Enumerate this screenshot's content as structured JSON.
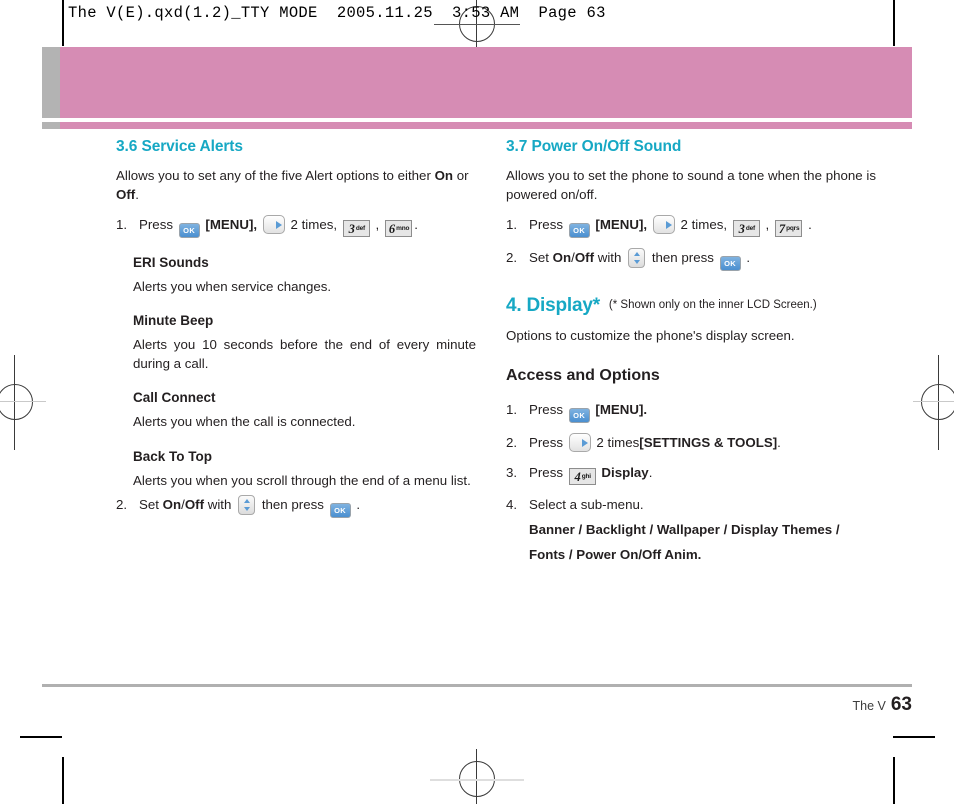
{
  "page": {
    "slug": "The V(E).qxd(1.2)_TTY MODE  2005.11.25  3:53 AM  Page 63",
    "footer_label": "The V",
    "footer_page": "63",
    "accent_color": "#16a8c4",
    "banner_color": "#d68cb4",
    "banner_tab_color": "#b3b3b3"
  },
  "left_column": {
    "section": {
      "number": "3.6",
      "title": "Service Alerts",
      "full_heading": "3.6 Service Alerts"
    },
    "intro_parts": {
      "a": "Allows you to set any of the five Alert options to either ",
      "on": "On",
      "b": " or ",
      "off": "Off",
      "c": "."
    },
    "step1": {
      "num": "1.",
      "press": "Press",
      "menu": "[MENU],",
      "times": "2 times,",
      "comma": ",",
      "period": "."
    },
    "subsections": [
      {
        "title": "ERI Sounds",
        "body": "Alerts you when service changes."
      },
      {
        "title": "Minute Beep",
        "body": "Alerts you 10 seconds before the end of every minute during a call."
      },
      {
        "title": "Call Connect",
        "body": "Alerts you when the call is connected."
      },
      {
        "title": "Back To Top",
        "body": "Alerts you when you scroll through the end of a menu list."
      }
    ],
    "step2": {
      "num": "2.",
      "set": "Set",
      "on": "On",
      "slash": "/",
      "off": "Off",
      "with": "with",
      "then_press": "then press",
      "period": "."
    },
    "keys": {
      "ok": "OK",
      "k3_digit": "3",
      "k3_letters": "def",
      "k6_digit": "6",
      "k6_letters": "mno"
    }
  },
  "right_column": {
    "section37": {
      "number": "3.7",
      "title": "Power On/Off Sound",
      "full_heading": "3.7 Power On/Off Sound",
      "body": "Allows you to set the phone to sound a tone when the phone is powered on/off.",
      "step1": {
        "num": "1.",
        "press": "Press",
        "menu": "[MENU],",
        "times": "2 times,",
        "comma": ",",
        "period": "."
      },
      "step2": {
        "num": "2.",
        "set": "Set",
        "on": "On",
        "slash": "/",
        "off": "Off",
        "with": "with",
        "then_press": "then press",
        "period": "."
      },
      "keys": {
        "ok": "OK",
        "k3_digit": "3",
        "k3_letters": "def",
        "k7_digit": "7",
        "k7_letters": "pqrs"
      }
    },
    "section4": {
      "heading": "4. Display*",
      "note": "(* Shown only on the inner LCD Screen.)",
      "body": "Options to customize the phone's display screen.",
      "access_heading": "Access and Options",
      "steps": [
        {
          "num": "1.",
          "press": "Press",
          "tail": "[MENU]."
        },
        {
          "num": "2.",
          "press": "Press",
          "times": "2 times",
          "tail_bold": "[SETTINGS & TOOLS]",
          "tail_end": "."
        },
        {
          "num": "3.",
          "press": "Press",
          "tail_bold": "Display",
          "tail_end": "."
        },
        {
          "num": "4.",
          "text": "Select a sub-menu.",
          "line1": "Banner / Backlight / Wallpaper / Display Themes /",
          "line2": "Fonts / Power On/Off Anim."
        }
      ],
      "keys": {
        "ok": "OK",
        "k4_digit": "4",
        "k4_letters": "ghi"
      }
    }
  }
}
